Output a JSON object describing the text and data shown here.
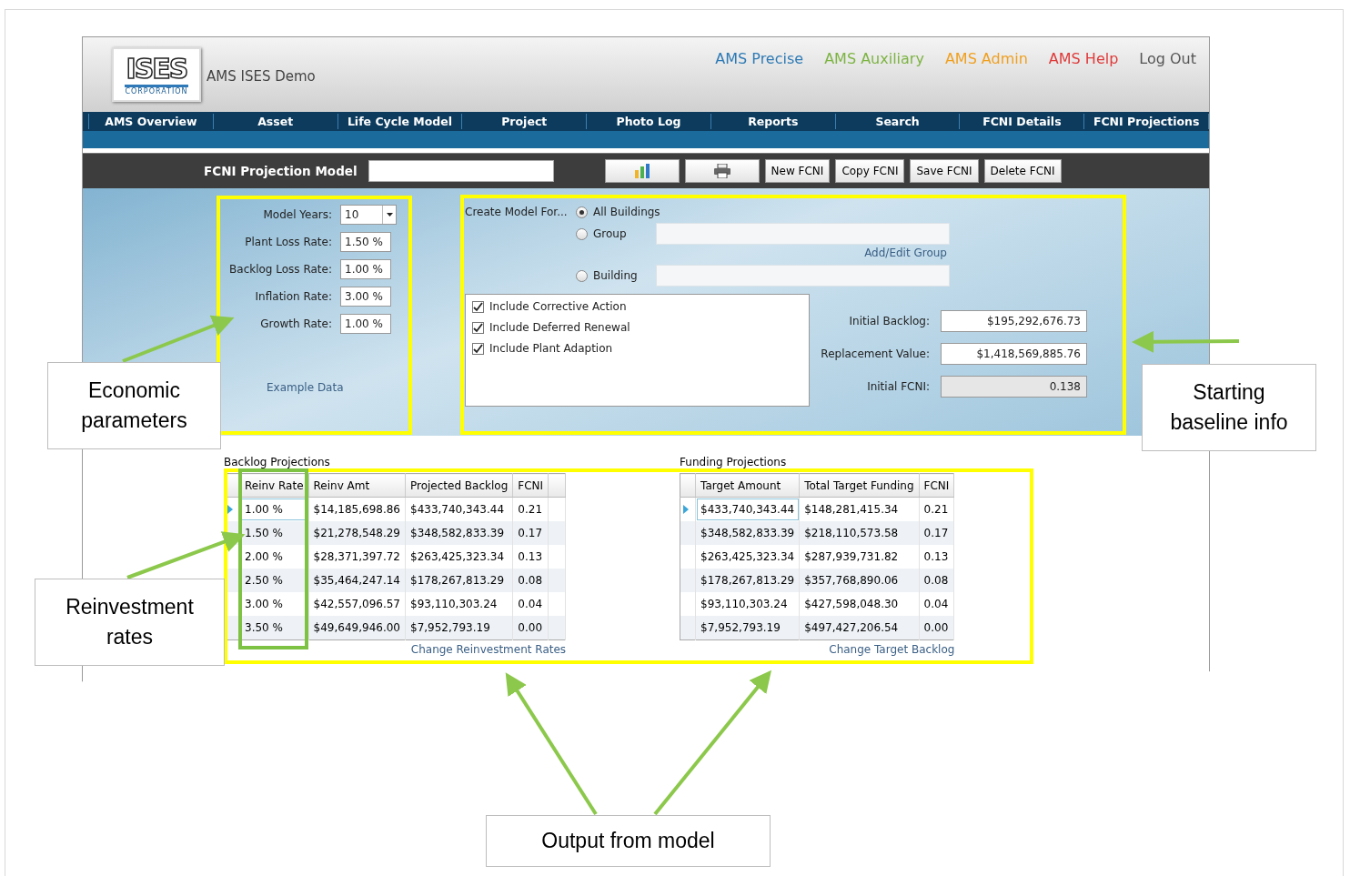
{
  "logo": {
    "name": "ISES",
    "tagline": "CORPORATION"
  },
  "app_title": "AMS ISES Demo",
  "top_links": [
    {
      "label": "AMS Precise",
      "color": "#2e7ab5"
    },
    {
      "label": "AMS Auxiliary",
      "color": "#7db443"
    },
    {
      "label": "AMS Admin",
      "color": "#f0a020"
    },
    {
      "label": "AMS Help",
      "color": "#e03a3a"
    },
    {
      "label": "Log Out",
      "color": "#555555"
    }
  ],
  "nav": [
    "AMS Overview",
    "Asset",
    "Life Cycle Model",
    "Project",
    "Photo Log",
    "Reports",
    "Search",
    "FCNI Details",
    "FCNI Projections"
  ],
  "toolbar": {
    "title": "FCNI Projection Model",
    "buttons": [
      {
        "kind": "chart"
      },
      {
        "kind": "print"
      },
      {
        "kind": "text",
        "label": "New FCNI"
      },
      {
        "kind": "text",
        "label": "Copy FCNI"
      },
      {
        "kind": "text",
        "label": "Save FCNI"
      },
      {
        "kind": "text",
        "label": "Delete FCNI"
      }
    ]
  },
  "economic": {
    "fields": [
      {
        "label": "Model Years:",
        "value": "10",
        "kind": "dropdown"
      },
      {
        "label": "Plant Loss Rate:",
        "value": "1.50 %",
        "kind": "text"
      },
      {
        "label": "Backlog Loss Rate:",
        "value": "1.00 %",
        "kind": "text"
      },
      {
        "label": "Inflation Rate:",
        "value": "3.00 %",
        "kind": "text"
      },
      {
        "label": "Growth Rate:",
        "value": "1.00 %",
        "kind": "text"
      }
    ],
    "link": "Example Data"
  },
  "create_model": {
    "label": "Create Model For...",
    "options": [
      {
        "label": "All Buildings",
        "selected": true,
        "dropdown": false
      },
      {
        "label": "Group",
        "selected": false,
        "dropdown": true
      },
      {
        "label": "Building",
        "selected": false,
        "dropdown": true
      }
    ],
    "group_link": "Add/Edit Group",
    "checkboxes": [
      {
        "label": "Include Corrective Action",
        "checked": true
      },
      {
        "label": "Include Deferred Renewal",
        "checked": true
      },
      {
        "label": "Include Plant Adaption",
        "checked": true
      }
    ],
    "summary": [
      {
        "label": "Initial Backlog:",
        "value": "$195,292,676.73",
        "disabled": false
      },
      {
        "label": "Replacement Value:",
        "value": "$1,418,569,885.76",
        "disabled": false
      },
      {
        "label": "Initial FCNI:",
        "value": "0.138",
        "disabled": true
      }
    ]
  },
  "backlog": {
    "title": "Backlog Projections",
    "columns": [
      "Reinv Rate",
      "Reinv Amt",
      "Projected Backlog",
      "FCNI"
    ],
    "rows": [
      {
        "cells": [
          "1.00 %",
          "$14,185,698.86",
          "$433,740,343.44",
          "0.21"
        ],
        "selected": true
      },
      {
        "cells": [
          "1.50 %",
          "$21,278,548.29",
          "$348,582,833.39",
          "0.17"
        ],
        "selected": false
      },
      {
        "cells": [
          "2.00 %",
          "$28,371,397.72",
          "$263,425,323.34",
          "0.13"
        ],
        "selected": false
      },
      {
        "cells": [
          "2.50 %",
          "$35,464,247.14",
          "$178,267,813.29",
          "0.08"
        ],
        "selected": false
      },
      {
        "cells": [
          "3.00 %",
          "$42,557,096.57",
          "$93,110,303.24",
          "0.04"
        ],
        "selected": false
      },
      {
        "cells": [
          "3.50 %",
          "$49,649,946.00",
          "$7,952,793.19",
          "0.00"
        ],
        "selected": false
      }
    ],
    "link": "Change Reinvestment Rates"
  },
  "funding": {
    "title": "Funding Projections",
    "columns": [
      "Target Amount",
      "Total Target Funding",
      "FCNI"
    ],
    "rows": [
      {
        "cells": [
          "$433,740,343.44",
          "$148,281,415.34",
          "0.21"
        ],
        "selected": true
      },
      {
        "cells": [
          "$348,582,833.39",
          "$218,110,573.58",
          "0.17"
        ],
        "selected": false
      },
      {
        "cells": [
          "$263,425,323.34",
          "$287,939,731.82",
          "0.13"
        ],
        "selected": false
      },
      {
        "cells": [
          "$178,267,813.29",
          "$357,768,890.06",
          "0.08"
        ],
        "selected": false
      },
      {
        "cells": [
          "$93,110,303.24",
          "$427,598,048.30",
          "0.04"
        ],
        "selected": false
      },
      {
        "cells": [
          "$7,952,793.19",
          "$497,427,206.54",
          "0.00"
        ],
        "selected": false
      }
    ],
    "link": "Change Target Backlog"
  },
  "annotations": [
    "Economic parameters",
    "Reinvestment rates",
    "Starting baseline info",
    "Output from model"
  ]
}
